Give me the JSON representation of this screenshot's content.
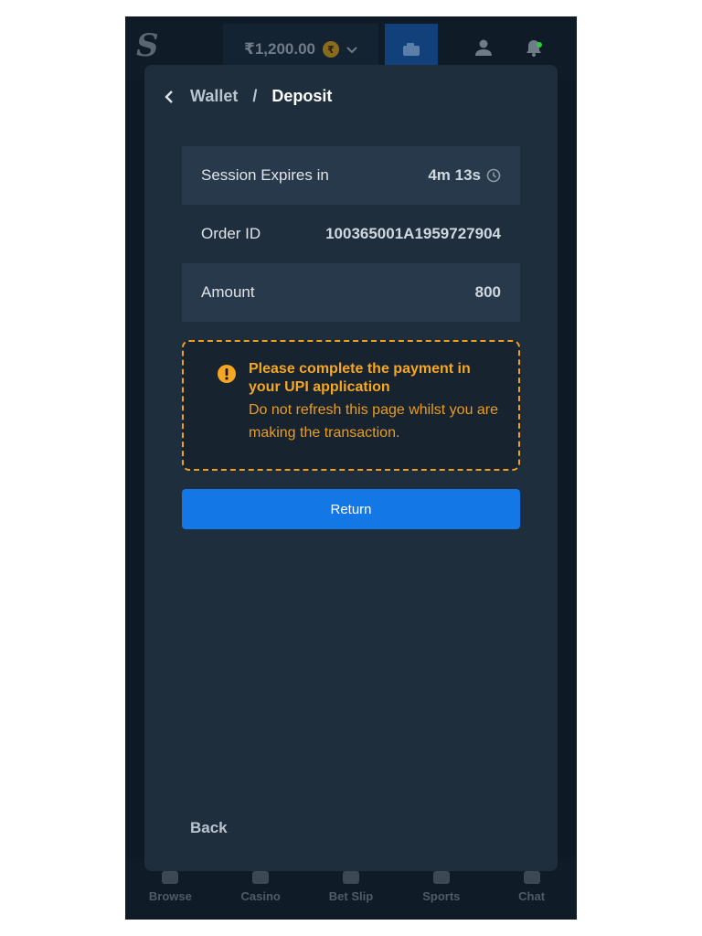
{
  "header": {
    "logo": "S",
    "balance": "₹1,200.00",
    "coin_symbol": "₹"
  },
  "bottom_nav": {
    "items": [
      {
        "label": "Browse"
      },
      {
        "label": "Casino"
      },
      {
        "label": "Bet Slip"
      },
      {
        "label": "Sports"
      },
      {
        "label": "Chat"
      }
    ]
  },
  "modal": {
    "breadcrumb": {
      "wallet": "Wallet",
      "separator": "/",
      "deposit": "Deposit"
    },
    "rows": [
      {
        "label": "Session Expires in",
        "value": "4m 13s"
      },
      {
        "label": "Order ID",
        "value": "100365001A1959727904"
      },
      {
        "label": "Amount",
        "value": "800"
      }
    ],
    "warning": {
      "title": "Please complete the payment in your UPI application",
      "text": "Do not refresh this page whilst you are making the transaction."
    },
    "return_label": "Return",
    "back_label": "Back"
  },
  "colors": {
    "accent": "#1477e6",
    "warning": "#f5a623",
    "modal_bg": "#1e2e3c"
  }
}
